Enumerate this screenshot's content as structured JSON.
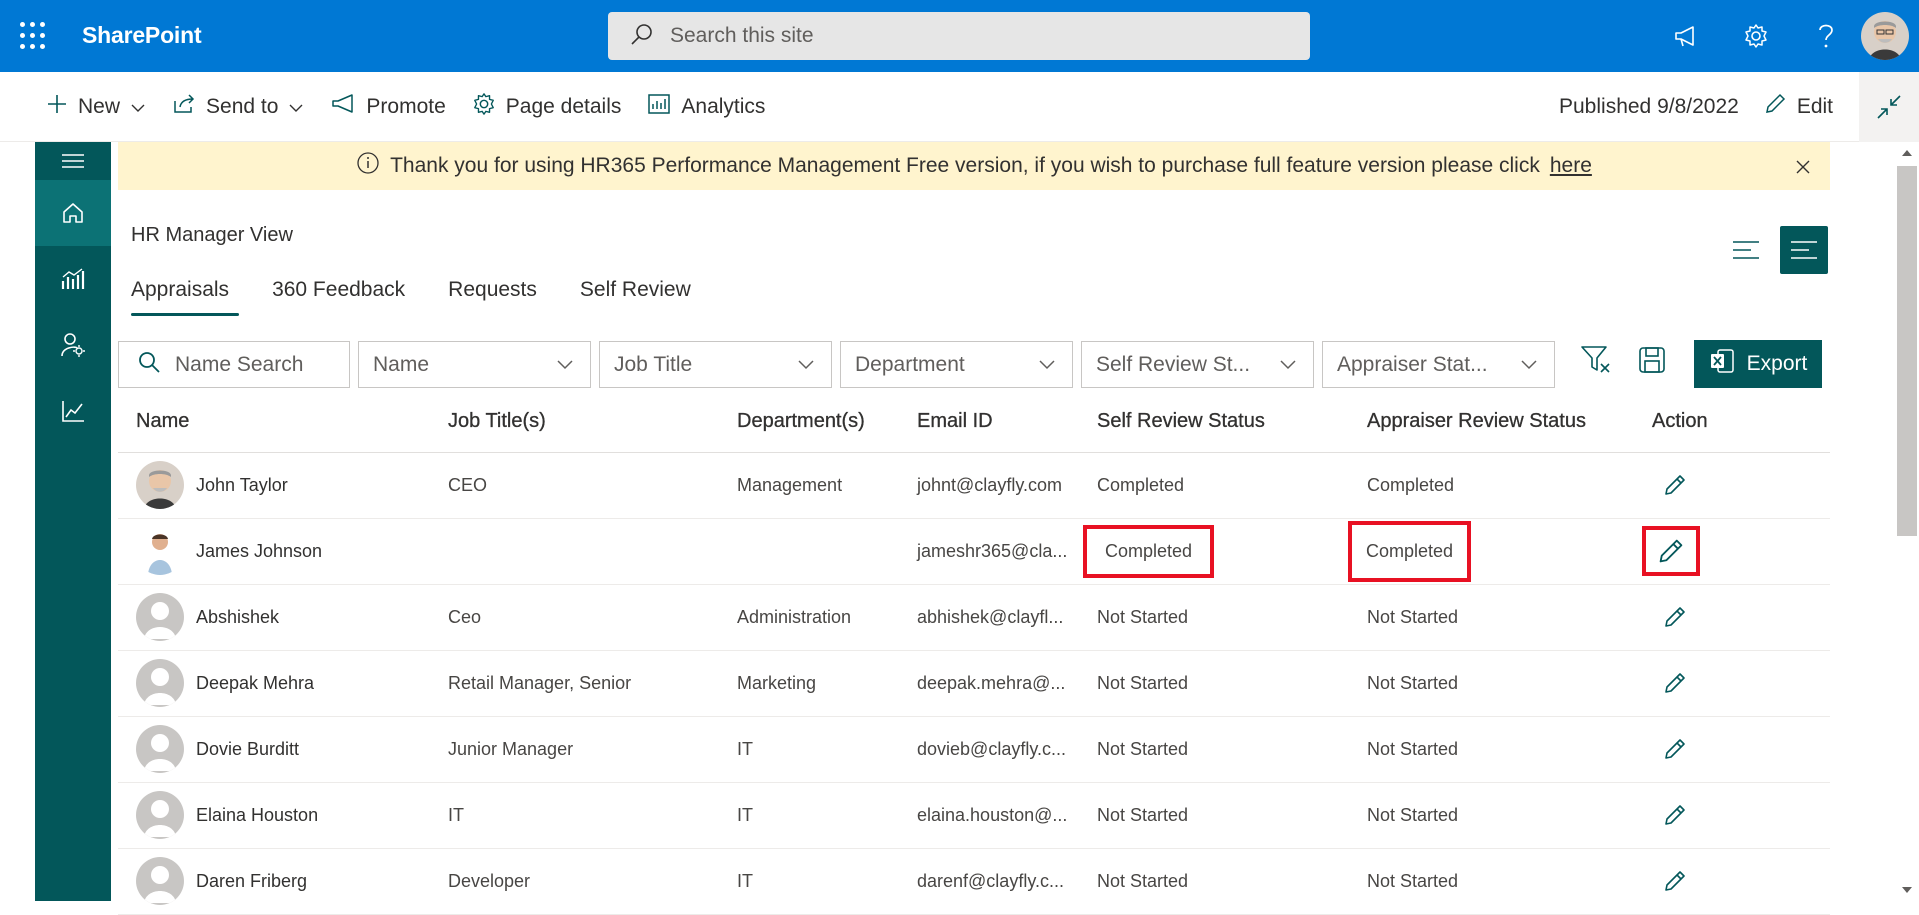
{
  "app": {
    "brand": "SharePoint",
    "search_placeholder": "Search this site"
  },
  "commandbar": {
    "new": "New",
    "send_to": "Send to",
    "promote": "Promote",
    "page_details": "Page details",
    "analytics": "Analytics",
    "published": "Published 9/8/2022",
    "edit": "Edit"
  },
  "banner": {
    "text": "Thank you for using HR365 Performance Management Free version, if you wish to purchase full feature version please click",
    "link": "here"
  },
  "view": {
    "title": "HR Manager View",
    "tabs": [
      "Appraisals",
      "360 Feedback",
      "Requests",
      "Self Review"
    ],
    "active_tab": "Appraisals"
  },
  "filters": {
    "name_search": "Name Search",
    "name": "Name",
    "job_title": "Job Title",
    "department": "Department",
    "self_review": "Self Review St...",
    "appraiser": "Appraiser Stat...",
    "export": "Export"
  },
  "table": {
    "headers": [
      "Name",
      "Job Title(s)",
      "Department(s)",
      "Email ID",
      "Self Review Status",
      "Appraiser Review Status",
      "Action"
    ],
    "rows": [
      {
        "name": "John Taylor",
        "job": "CEO",
        "dept": "Management",
        "email": "johnt@clayfly.com",
        "self": "Completed",
        "appraiser": "Completed"
      },
      {
        "name": "James Johnson",
        "job": "",
        "dept": "",
        "email": "jameshr365@cla...",
        "self": "Completed",
        "appraiser": "Completed"
      },
      {
        "name": "Abshishek",
        "job": "Ceo",
        "dept": "Administration",
        "email": "abhishek@clayfl...",
        "self": "Not Started",
        "appraiser": "Not Started"
      },
      {
        "name": "Deepak Mehra",
        "job": "Retail Manager, Senior",
        "dept": "Marketing",
        "email": "deepak.mehra@...",
        "self": "Not Started",
        "appraiser": "Not Started"
      },
      {
        "name": "Dovie Burditt",
        "job": "Junior Manager",
        "dept": "IT",
        "email": "dovieb@clayfly.c...",
        "self": "Not Started",
        "appraiser": "Not Started"
      },
      {
        "name": "Elaina Houston",
        "job": "IT",
        "dept": "IT",
        "email": "elaina.houston@...",
        "self": "Not Started",
        "appraiser": "Not Started"
      },
      {
        "name": "Daren Friberg",
        "job": "Developer",
        "dept": "IT",
        "email": "darenf@clayfly.c...",
        "self": "Not Started",
        "appraiser": "Not Started"
      }
    ]
  },
  "colors": {
    "suite_bar": "#0078d4",
    "accent": "#03575a",
    "banner": "#fff4ce",
    "highlight": "#e81123"
  }
}
